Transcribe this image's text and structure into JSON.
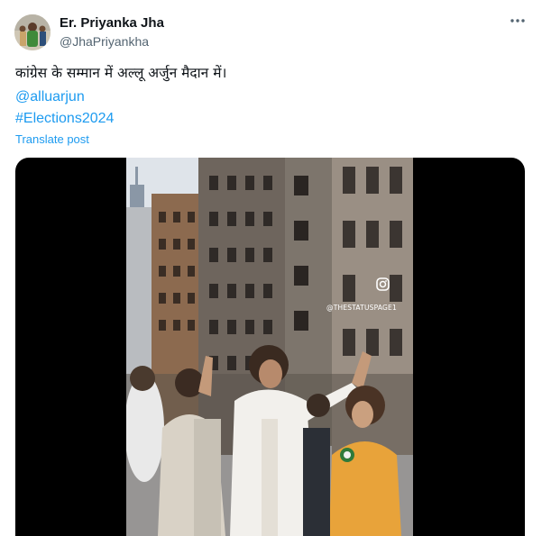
{
  "author": {
    "display_name": "Er. Priyanka Jha",
    "handle": "@JhaPriyankha"
  },
  "post": {
    "text": "कांग्रेस के सम्मान में अल्लू अर्जुन मैदान में।",
    "mention": "@alluarjun",
    "hashtag": "#Elections2024",
    "translate_label": "Translate post"
  },
  "media": {
    "watermark": "@THESTATUSPAGE1"
  },
  "colors": {
    "link": "#1d9bf0",
    "text": "#0f1419",
    "secondary": "#536471"
  },
  "icons": [
    "more-icon",
    "instagram-icon"
  ]
}
